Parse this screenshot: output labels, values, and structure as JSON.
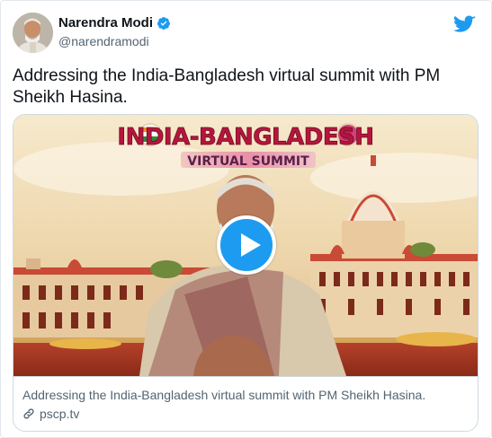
{
  "author": {
    "name": "Narendra Modi",
    "handle": "@narendramodi",
    "verified": true
  },
  "tweet": {
    "text": "Addressing the India-Bangladesh virtual summit with PM Sheikh Hasina."
  },
  "card": {
    "media_title_line1": "INDIA-BANGLADESH",
    "media_title_line2": "VIRTUAL SUMMIT",
    "description": "Addressing the India-Bangladesh virtual summit with PM Sheikh Hasina.",
    "domain": "pscp.tv"
  },
  "icons": {
    "brand": "twitter-bird-icon",
    "verified": "verified-badge-icon",
    "play": "play-icon",
    "link": "link-icon"
  },
  "colors": {
    "accent": "#1d9bf0",
    "text": "#0f1419",
    "secondary_text": "#536471"
  }
}
